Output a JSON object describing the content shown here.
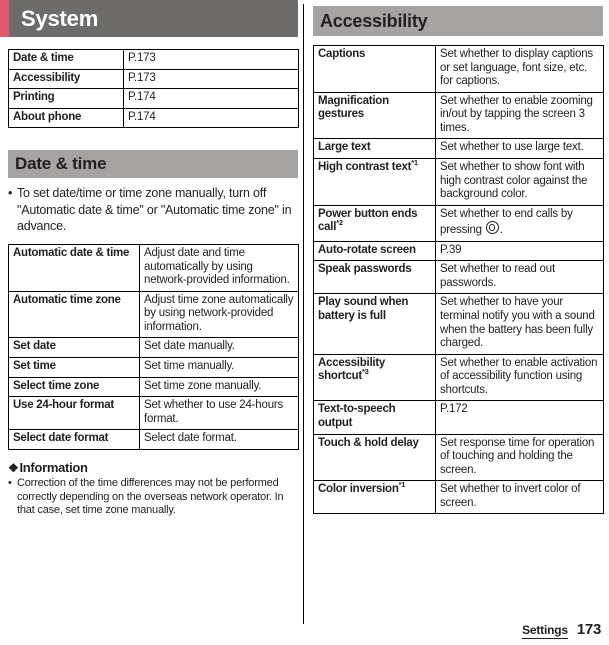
{
  "document": {
    "chapter_title": "System",
    "accent_color": "#e0596c",
    "chapter_bar_color": "#6e6c6b",
    "section_bar_color": "#a5a3a2"
  },
  "footer": {
    "section_label": "Settings",
    "page_number": "173"
  },
  "left_column": {
    "system_links": {
      "rows": [
        {
          "name": "Date & time",
          "ref": "P.173"
        },
        {
          "name": "Accessibility",
          "ref": "P.173"
        },
        {
          "name": "Printing",
          "ref": "P.174"
        },
        {
          "name": "About phone",
          "ref": "P.174"
        }
      ]
    },
    "date_time_section": {
      "heading": "Date & time",
      "notes": [
        "To set date/time or time zone manually, turn off \"Automatic date & time\" or \"Automatic time zone\" in advance."
      ],
      "rows": [
        {
          "name": "Automatic date & time",
          "desc": "Adjust date and time automatically by using network-provided information."
        },
        {
          "name": "Automatic time zone",
          "desc": "Adjust time zone automatically by using network-provided information."
        },
        {
          "name": "Set date",
          "desc": "Set date manually."
        },
        {
          "name": "Set time",
          "desc": "Set time manually."
        },
        {
          "name": "Select time zone",
          "desc": "Set time zone manually."
        },
        {
          "name": "Use 24-hour format",
          "desc": "Set whether to use 24-hours format."
        },
        {
          "name": "Select date format",
          "desc": "Select date format."
        }
      ]
    },
    "information": {
      "icon": "diamond-ornament-icon",
      "icon_glyph": "❖",
      "heading": "Information",
      "items": [
        "Correction of the time differences may not be performed correctly depending on the overseas network operator. In that case, set time zone manually."
      ]
    }
  },
  "right_column": {
    "accessibility_section": {
      "heading": "Accessibility",
      "rows": [
        {
          "name": "Captions",
          "sup": "",
          "desc": "Set whether to display captions or set language, font size, etc. for captions.",
          "icon": ""
        },
        {
          "name": "Magnification gestures",
          "sup": "",
          "desc": "Set whether to enable zooming in/out by tapping the screen 3 times.",
          "icon": ""
        },
        {
          "name": "Large text",
          "sup": "",
          "desc": "Set whether to use large text.",
          "icon": ""
        },
        {
          "name": "High contrast text",
          "sup": "*1",
          "desc": "Set whether to show font with high contrast color against the background color.",
          "icon": ""
        },
        {
          "name": "Power button ends call",
          "sup": "*2",
          "desc_before": "Set whether to end calls by pressing ",
          "desc_after": ".",
          "icon": "power-button-icon"
        },
        {
          "name": "Auto-rotate screen",
          "sup": "",
          "desc": "P.39",
          "icon": ""
        },
        {
          "name": "Speak passwords",
          "sup": "",
          "desc": "Set whether to read out passwords.",
          "icon": ""
        },
        {
          "name": "Play sound when battery is full",
          "sup": "",
          "desc": "Set whether to have your terminal notify you with a sound when the battery has been fully charged.",
          "icon": ""
        },
        {
          "name": "Accessibility shortcut",
          "sup": "*3",
          "desc": "Set whether to enable activation of accessibility function using shortcuts.",
          "icon": ""
        },
        {
          "name": "Text-to-speech output",
          "sup": "",
          "desc": "P.172",
          "icon": ""
        },
        {
          "name": "Touch & hold delay",
          "sup": "",
          "desc": "Set response time for operation of touching and holding the screen.",
          "icon": ""
        },
        {
          "name": "Color inversion",
          "sup": "*1",
          "desc": "Set whether to invert color of screen.",
          "icon": ""
        }
      ]
    }
  }
}
